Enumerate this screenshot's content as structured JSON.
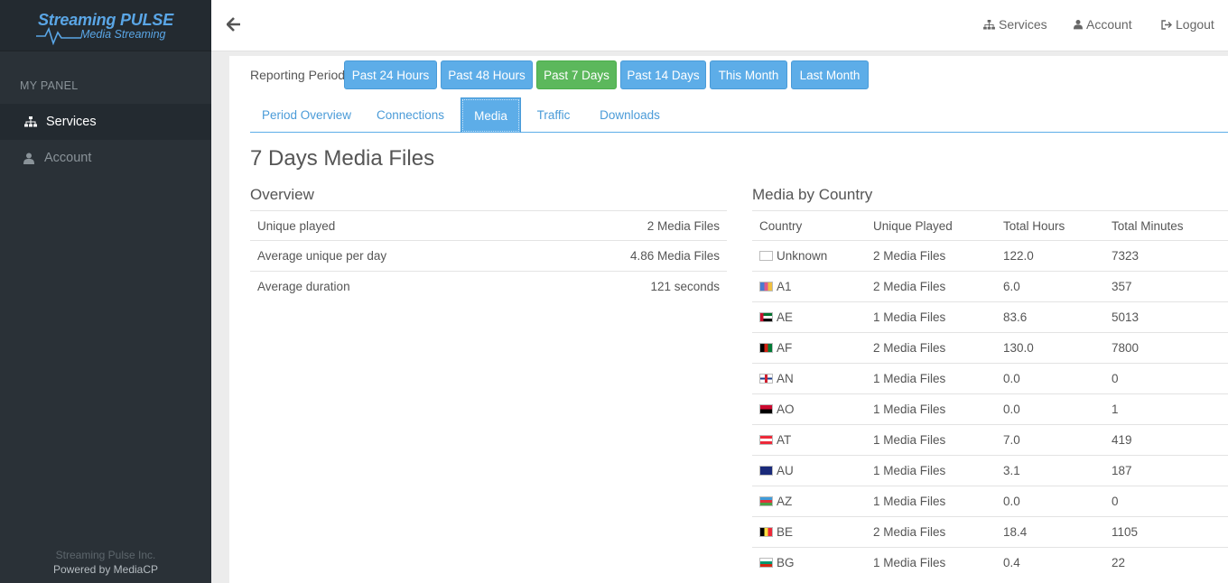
{
  "brand": {
    "title": "Streaming PULSE",
    "subtitle": "Media Streaming"
  },
  "sidebar": {
    "section_label": "MY PANEL",
    "items": [
      {
        "label": "Services",
        "icon": "sitemap-icon",
        "active": true
      },
      {
        "label": "Account",
        "icon": "user-icon",
        "active": false
      }
    ],
    "footer_company": "Streaming Pulse Inc.",
    "footer_powered": "Powered by MediaCP"
  },
  "topbar": {
    "links": {
      "services": "Services",
      "account": "Account",
      "logout": "Logout"
    }
  },
  "reporting": {
    "label": "Reporting Period:",
    "buttons": [
      {
        "label": "Past 24 Hours",
        "selected": false
      },
      {
        "label": "Past 48 Hours",
        "selected": false
      },
      {
        "label": "Past 7 Days",
        "selected": true
      },
      {
        "label": "Past 14 Days",
        "selected": false
      },
      {
        "label": "This Month",
        "selected": false
      },
      {
        "label": "Last Month",
        "selected": false
      }
    ]
  },
  "tabs": [
    {
      "label": "Period Overview",
      "active": false
    },
    {
      "label": "Connections",
      "active": false
    },
    {
      "label": "Media",
      "active": true
    },
    {
      "label": "Traffic",
      "active": false
    },
    {
      "label": "Downloads",
      "active": false
    }
  ],
  "page_title": "7 Days Media Files",
  "overview": {
    "title": "Overview",
    "rows": [
      {
        "label": "Unique played",
        "value": "2 Media Files"
      },
      {
        "label": "Average unique per day",
        "value": "4.86 Media Files"
      },
      {
        "label": "Average duration",
        "value": "121 seconds"
      }
    ]
  },
  "by_country": {
    "title": "Media by Country",
    "headers": [
      "Country",
      "Unique Played",
      "Total Hours",
      "Total Minutes"
    ],
    "rows": [
      {
        "country": "Unknown",
        "flag": "unknown",
        "unique": "2 Media Files",
        "hours": "122.0",
        "minutes": "7323"
      },
      {
        "country": "A1",
        "flag": "a1",
        "unique": "2 Media Files",
        "hours": "6.0",
        "minutes": "357"
      },
      {
        "country": "AE",
        "flag": "ae",
        "unique": "1 Media Files",
        "hours": "83.6",
        "minutes": "5013"
      },
      {
        "country": "AF",
        "flag": "af",
        "unique": "2 Media Files",
        "hours": "130.0",
        "minutes": "7800"
      },
      {
        "country": "AN",
        "flag": "an",
        "unique": "1 Media Files",
        "hours": "0.0",
        "minutes": "0"
      },
      {
        "country": "AO",
        "flag": "ao",
        "unique": "1 Media Files",
        "hours": "0.0",
        "minutes": "1"
      },
      {
        "country": "AT",
        "flag": "at",
        "unique": "1 Media Files",
        "hours": "7.0",
        "minutes": "419"
      },
      {
        "country": "AU",
        "flag": "au",
        "unique": "1 Media Files",
        "hours": "3.1",
        "minutes": "187"
      },
      {
        "country": "AZ",
        "flag": "az",
        "unique": "1 Media Files",
        "hours": "0.0",
        "minutes": "0"
      },
      {
        "country": "BE",
        "flag": "be",
        "unique": "2 Media Files",
        "hours": "18.4",
        "minutes": "1105"
      },
      {
        "country": "BG",
        "flag": "bg",
        "unique": "1 Media Files",
        "hours": "0.4",
        "minutes": "22"
      }
    ]
  },
  "colors": {
    "accent": "#5dade8",
    "selected": "#5cb85c",
    "sidebar": "#2a3137"
  }
}
